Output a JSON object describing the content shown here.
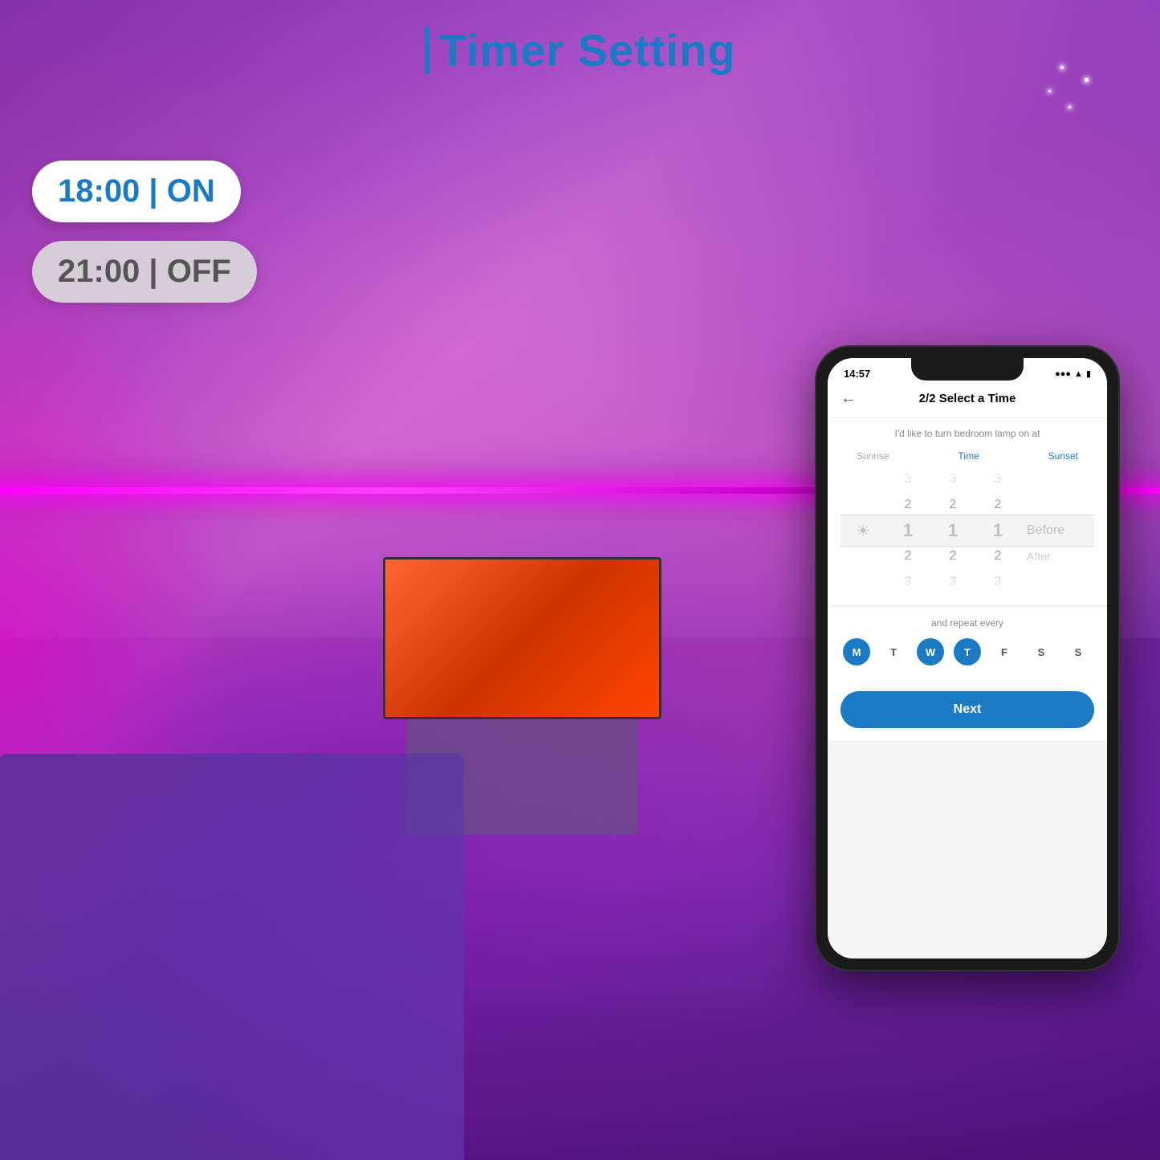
{
  "page": {
    "title": "Timer Setting",
    "title_bar_label": "|"
  },
  "timers": {
    "on": "18:00 | ON",
    "off": "21:00 | OFF"
  },
  "phone": {
    "status_bar": {
      "time": "14:57",
      "signal": "●●●",
      "wifi": "WiFi",
      "battery": "🔋"
    },
    "header": {
      "step": "2/2 Select a Time",
      "back_label": "←"
    },
    "subtitle": "I'd like to turn bedroom lamp on at",
    "picker": {
      "col1_label": "Sunrise",
      "col2_label": "Time",
      "col3_label": "Sunset",
      "col1_items": [
        "3",
        "2",
        "1",
        "2",
        "3"
      ],
      "col2_items": [
        "3",
        "2",
        "1",
        "2",
        "3"
      ],
      "col3_items": [
        "3",
        "2",
        "1",
        "2",
        "3"
      ],
      "side_items": [
        "",
        "",
        "Before",
        "After",
        ""
      ],
      "selected_index": 2
    },
    "repeat": {
      "label": "and repeat every",
      "days": [
        {
          "label": "M",
          "active": true
        },
        {
          "label": "T",
          "active": false
        },
        {
          "label": "W",
          "active": true
        },
        {
          "label": "T",
          "active": true
        },
        {
          "label": "F",
          "active": false
        },
        {
          "label": "S",
          "active": false
        },
        {
          "label": "S",
          "active": false
        }
      ]
    },
    "next_button": "Next"
  }
}
